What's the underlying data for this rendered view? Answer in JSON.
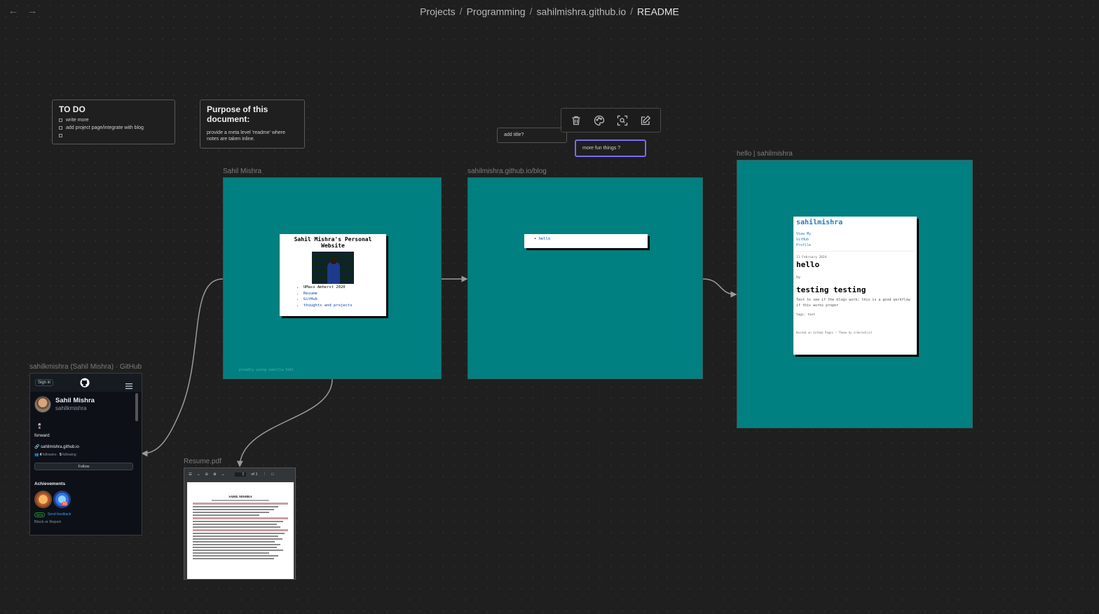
{
  "breadcrumb": [
    "Projects",
    "Programming",
    "sahilmishra.github.io",
    "README"
  ],
  "notes": {
    "todo": {
      "title": "TO DO",
      "items": [
        "write more",
        "add project page/integrate with blog",
        ""
      ]
    },
    "purpose": {
      "title": "Purpose of this document:",
      "body": "provide a meta level 'readme' where notes are taken inline."
    },
    "add_title": "add title?",
    "more_fun": "more fun things ?"
  },
  "toolbar": {
    "buttons": [
      "trash-icon",
      "palette-icon",
      "zoom-fit-icon",
      "edit-icon"
    ]
  },
  "frames": {
    "personal": {
      "label": "Sahil Mishra",
      "heading": "Sahil Mishra's Personal Website",
      "list": [
        "UMass Amherst 2020",
        "Resume",
        "GitHub",
        "thoughts and projects"
      ],
      "footer": "proudly using vanilla html"
    },
    "blog": {
      "label": "sahilmishra.github.io/blog",
      "item": "hello"
    },
    "hello": {
      "label": "hello | sahilmishra",
      "site": "sahilmishra",
      "links": [
        "View My",
        "GitHub",
        "Profile"
      ],
      "date": "11 February 2024",
      "title": "hello",
      "by": "by",
      "subtitle": "testing testing",
      "body": "Test to see if the blogs work; this is a good workflow if this works proper",
      "tags": "tags: test",
      "footer": "Hosted on GitHub Pages — Theme by orderedlist"
    }
  },
  "github": {
    "label": "sahilkmishra (Sahil Mishra) · GitHub",
    "signin": "Sign in",
    "name": "Sahil Mishra",
    "username": "sahilkmishra",
    "status_emoji": "🍷",
    "bio": "forward",
    "site": "sahilmishra.github.io",
    "followers": "4",
    "followers_label": "followers",
    "following": "5",
    "following_label": "following",
    "follow_button": "Follow",
    "achievements_title": "Achievements",
    "badge_count": "x2",
    "beta": "Beta",
    "feedback": "Send feedback",
    "block": "Block or Report"
  },
  "pdf": {
    "label": "Resume.pdf",
    "page": "1",
    "of": "of 1",
    "doc_title": "SAHIL MISHRA"
  },
  "colors": {
    "canvas": "#1f1f1f",
    "frame": "#008080",
    "accent": "#7b6cf0"
  }
}
